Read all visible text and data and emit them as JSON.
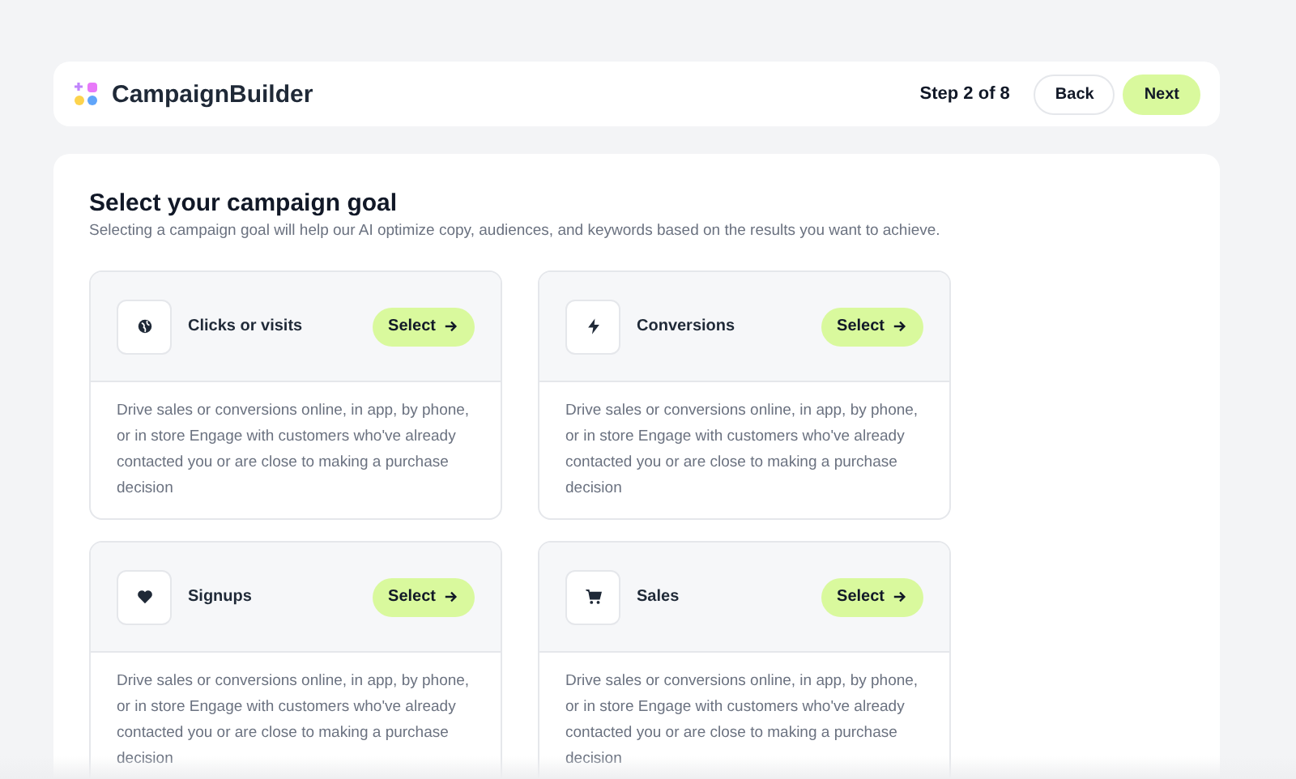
{
  "header": {
    "brand": "CampaignBuilder",
    "step": "Step 2 of 8",
    "buttons": [
      {
        "label": "Back",
        "kind": "secondary"
      },
      {
        "label": "Next",
        "kind": "primary"
      }
    ]
  },
  "main": {
    "title": "Select your campaign goal",
    "subtitle": "Selecting a campaign goal will help our AI optimize copy, audiences, and keywords based on the results you want to achieve.",
    "goals": [
      {
        "kind": "clicks",
        "name": "Clicks or visits",
        "action": "Select",
        "description": "Drive sales or conversions online, in app, by phone, or in store Engage with customers who've already contacted you or are close to making a purchase decision"
      },
      {
        "kind": "conversions",
        "name": "Conversions",
        "action": "Select",
        "description": "Drive sales or conversions online, in app, by phone, or in store Engage with customers who've already contacted you or are close to making a purchase decision"
      },
      {
        "kind": "signups",
        "name": "Signups",
        "action": "Select",
        "description": "Drive sales or conversions online, in app, by phone, or in store Engage with customers who've already contacted you or are close to making a purchase decision"
      },
      {
        "kind": "sales",
        "name": "Sales",
        "action": "Select",
        "description": "Drive sales or conversions online, in app, by phone, or in store Engage with customers who've already contacted you or are close to making a purchase decision"
      }
    ]
  }
}
